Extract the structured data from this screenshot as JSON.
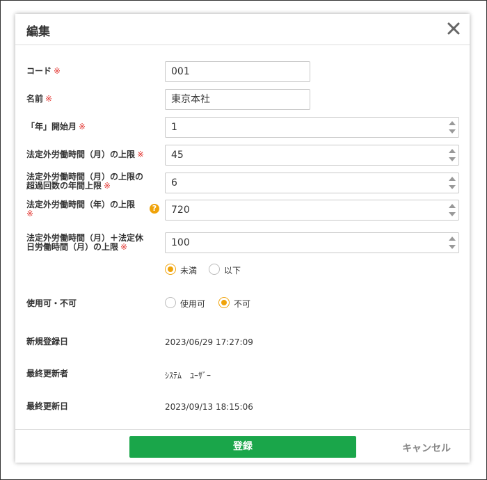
{
  "dialog": {
    "title": "編集",
    "required_mark": "※",
    "help_mark": "?"
  },
  "fields": {
    "code": {
      "label": "コード",
      "value": "001"
    },
    "name": {
      "label": "名前",
      "value": "東京本社"
    },
    "start_month": {
      "label": "「年」開始月",
      "value": "1"
    },
    "monthly_limit": {
      "label": "法定外労働時間（月）の上限",
      "value": "45"
    },
    "monthly_exceed_count": {
      "label_line1": "法定外労働時間（月）の上限の",
      "label_line2": "超過回数の年間上限",
      "value": "6"
    },
    "yearly_limit": {
      "label": "法定外労働時間（年）の上限",
      "value": "720"
    },
    "combined_limit": {
      "label_line1": "法定外労働時間（月）＋法定休",
      "label_line2": "日労働時間（月）の上限",
      "value": "100"
    },
    "combined_comparison": {
      "options": [
        "未満",
        "以下"
      ],
      "selected": "未満"
    },
    "availability": {
      "label": "使用可・不可",
      "options": [
        "使用可",
        "不可"
      ],
      "selected": "不可"
    }
  },
  "info": {
    "created": {
      "label": "新規登録日",
      "value": "2023/06/29 17:27:09"
    },
    "updated_by": {
      "label": "最終更新者",
      "value": "ｼｽﾃﾑ　ﾕｰｻﾞｰ"
    },
    "updated": {
      "label": "最終更新日",
      "value": "2023/09/13 18:15:06"
    }
  },
  "footer": {
    "save_label": "登録",
    "cancel_label": "キャンセル"
  },
  "colors": {
    "accent": "#f0a30a",
    "save_button": "#1aa64a",
    "required": "#e3342f"
  }
}
